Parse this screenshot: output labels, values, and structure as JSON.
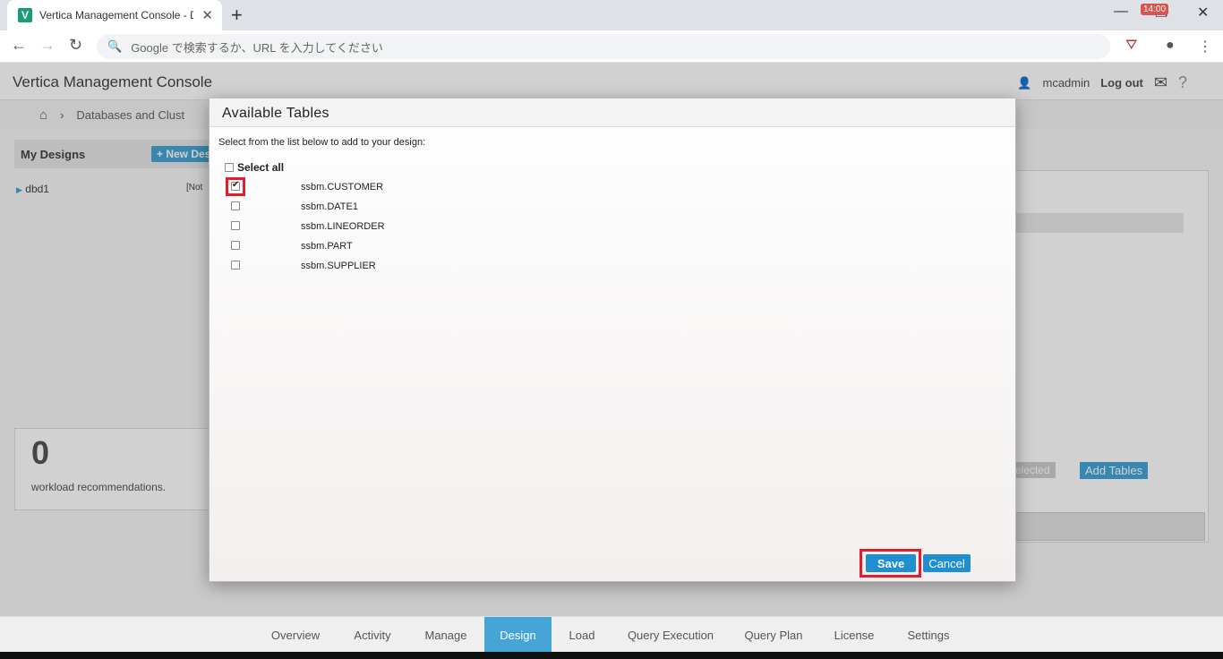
{
  "browser": {
    "tab_title": "Vertica Management Console - D",
    "favicon_letter": "V",
    "omnibox_placeholder": "Google で検索するか、URL を入力してください"
  },
  "app": {
    "title": "Vertica Management Console",
    "user": "mcadmin",
    "logout": "Log out",
    "mail_badge": "14:00",
    "breadcrumb": "Databases and Clust",
    "left_panel_title": "My Designs",
    "new_design_btn": "+ New Des",
    "tree_item": "dbd1",
    "tree_status": "[Not",
    "reco_count": "0",
    "reco_label": "workload recommendations.",
    "right_btn_remove": "e Selected",
    "right_btn_add": "Add Tables"
  },
  "modal": {
    "title": "Available Tables",
    "instruction": "Select from the list below to add to your design:",
    "select_all": "Select all",
    "tables": [
      {
        "name": "ssbm.CUSTOMER",
        "checked": true
      },
      {
        "name": "ssbm.DATE1",
        "checked": false
      },
      {
        "name": "ssbm.LINEORDER",
        "checked": false
      },
      {
        "name": "ssbm.PART",
        "checked": false
      },
      {
        "name": "ssbm.SUPPLIER",
        "checked": false
      }
    ],
    "save": "Save",
    "cancel": "Cancel"
  },
  "bottom_nav": {
    "items": [
      "Overview",
      "Activity",
      "Manage",
      "Design",
      "Load",
      "Query Execution",
      "Query Plan",
      "License",
      "Settings"
    ],
    "active": "Design"
  },
  "colors": {
    "accent": "#46a5d6",
    "button": "#1f8fd1",
    "highlight": "#e01e2e"
  }
}
